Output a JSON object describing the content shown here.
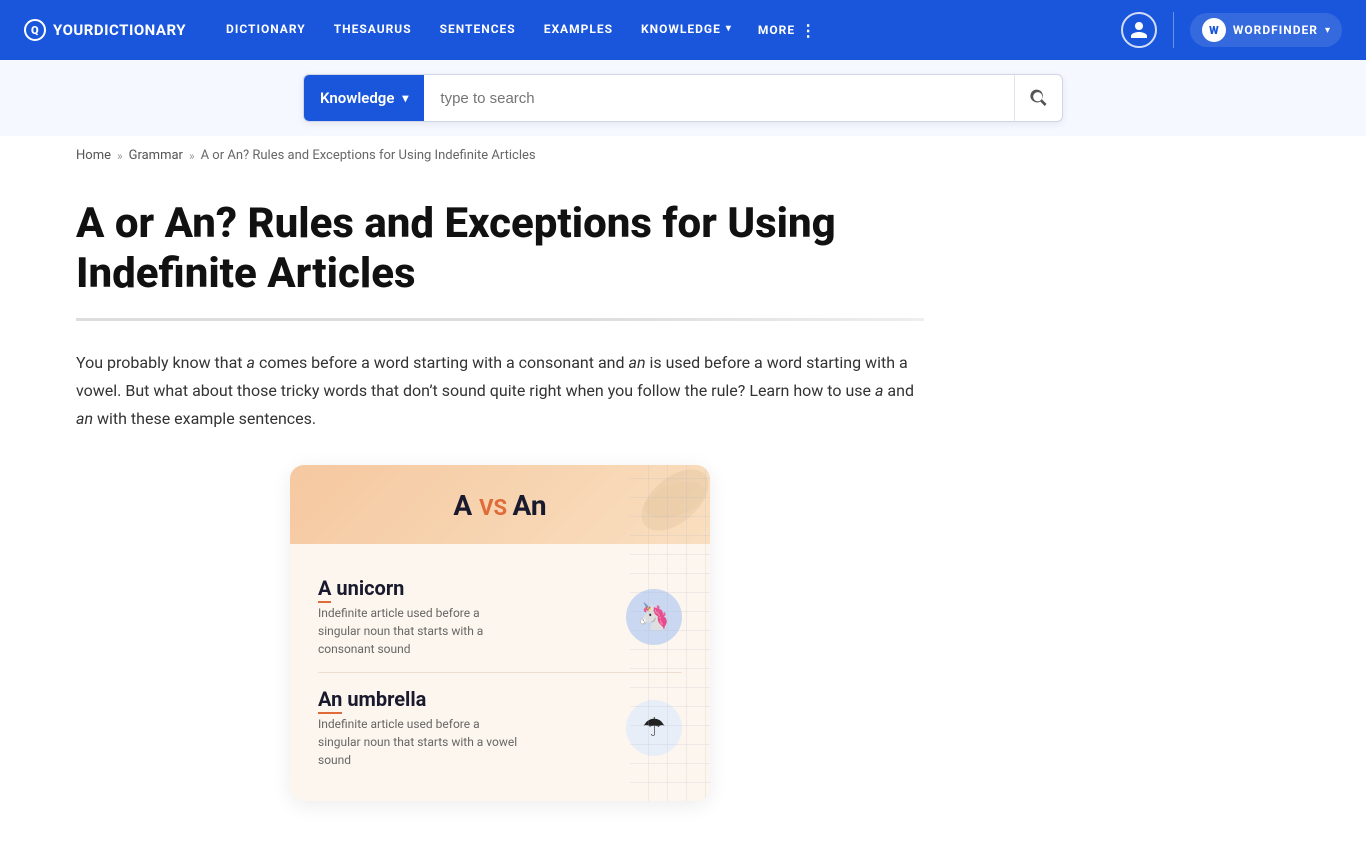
{
  "nav": {
    "logo_text": "YOURDICTIONARY",
    "links": [
      {
        "label": "DICTIONARY",
        "has_arrow": false
      },
      {
        "label": "THESAURUS",
        "has_arrow": false
      },
      {
        "label": "SENTENCES",
        "has_arrow": false
      },
      {
        "label": "EXAMPLES",
        "has_arrow": false
      },
      {
        "label": "KNOWLEDGE",
        "has_arrow": true
      },
      {
        "label": "MORE",
        "has_arrow": false,
        "has_dots": true
      }
    ],
    "wordfinder_label": "WORDFINDER"
  },
  "search": {
    "dropdown_label": "Knowledge",
    "placeholder": "type to search"
  },
  "breadcrumb": {
    "home": "Home",
    "grammar": "Grammar",
    "current": "A or An? Rules and Exceptions for Using Indefinite Articles"
  },
  "article": {
    "title": "A or An? Rules and Exceptions for Using Indefinite Articles",
    "intro_p1": "You probably know that ",
    "intro_a": "a",
    "intro_p2": " comes before a word starting with a consonant and ",
    "intro_an": "an",
    "intro_p3": " is used before a word starting with a vowel. But what about those tricky words that don’t sound quite right when you follow the rule? Learn how to use ",
    "intro_a2": "a",
    "intro_p4": " and ",
    "intro_an2": "an",
    "intro_p5": " with these example sentences."
  },
  "infographic": {
    "title_a": "A",
    "title_vs": "VS",
    "title_an": "An",
    "row1_word": "A unicorn",
    "row1_desc": "Indefinite article used before a singular noun that starts with a consonant sound",
    "row1_icon": "🦄",
    "row2_word": "An umbrella",
    "row2_desc": "Indefinite article used before a singular noun that starts with a vowel sound",
    "row2_icon": "☂"
  },
  "colors": {
    "nav_bg": "#1a56db",
    "accent_orange": "#e06b3a"
  }
}
